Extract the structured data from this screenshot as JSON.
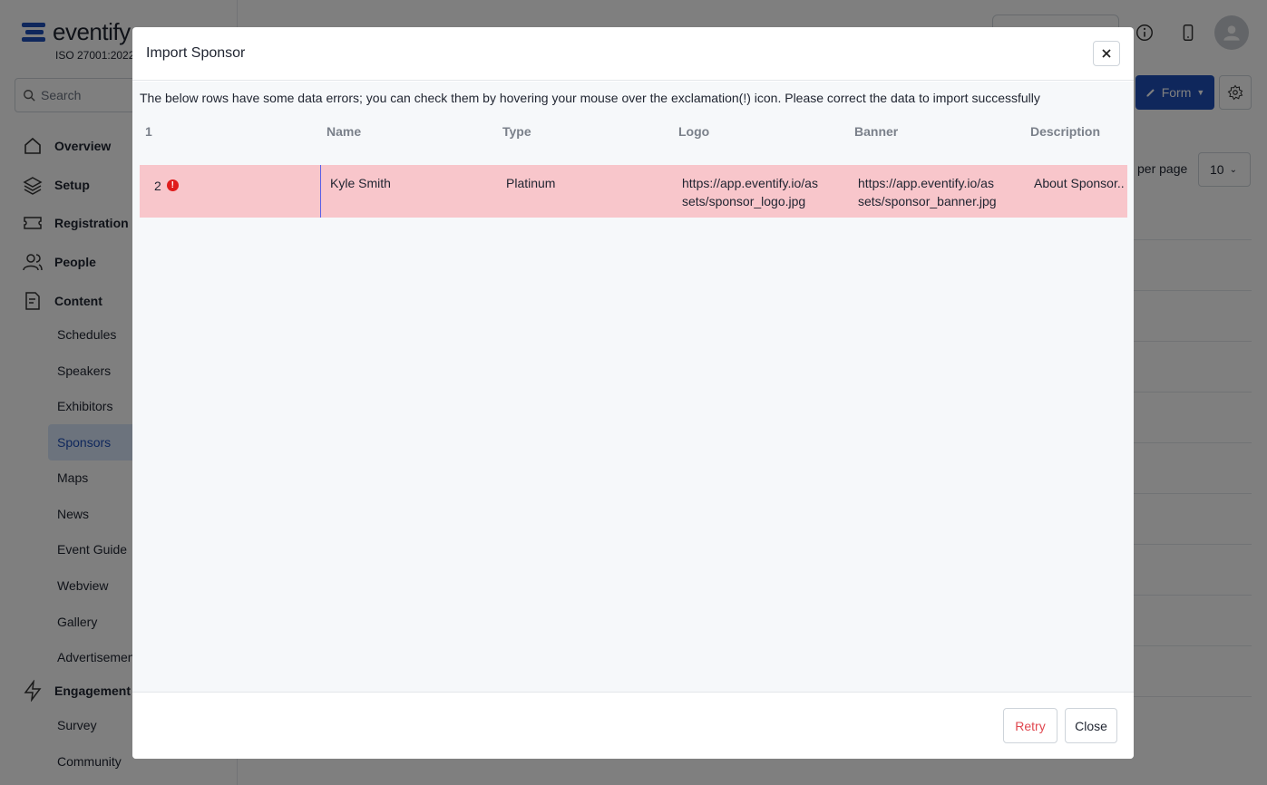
{
  "brand": {
    "logo_text": "eventify",
    "iso": "ISO 27001:2022"
  },
  "sidebar": {
    "search_placeholder": "Search",
    "nav": [
      {
        "label": "Overview",
        "icon": "home-icon"
      },
      {
        "label": "Setup",
        "icon": "layers-icon"
      },
      {
        "label": "Registration",
        "icon": "ticket-icon"
      },
      {
        "label": "People",
        "icon": "people-icon"
      },
      {
        "label": "Content",
        "icon": "document-icon"
      }
    ],
    "content_items": [
      "Schedules",
      "Speakers",
      "Exhibitors",
      "Sponsors",
      "Maps",
      "News",
      "Event Guide",
      "Webview",
      "Gallery",
      "Advertisement"
    ],
    "active_item": "Sponsors",
    "engagement": {
      "label": "Engagement",
      "icon": "bolt-icon"
    },
    "engagement_items": [
      "Survey",
      "Community"
    ]
  },
  "toolbar": {
    "form_label": "Form",
    "per_page_label": "per page",
    "per_page_value": "10"
  },
  "modal": {
    "title": "Import Sponsor",
    "message": "The below rows have some data errors; you can check them by hovering your mouse over the exclamation(!) icon. Please correct the data to import successfully",
    "columns": [
      "1",
      "Name",
      "Type",
      "Logo",
      "Banner",
      "Description"
    ],
    "rows": [
      {
        "row_num": "2",
        "name": "Kyle Smith",
        "type": "Platinum",
        "logo": "https://app.eventify.io/as\nsets/sponsor_logo.jpg",
        "banner": "https://app.eventify.io/as\nsets/sponsor_banner.jpg",
        "description": "About Sponsor.."
      }
    ],
    "retry_label": "Retry",
    "close_label": "Close"
  }
}
